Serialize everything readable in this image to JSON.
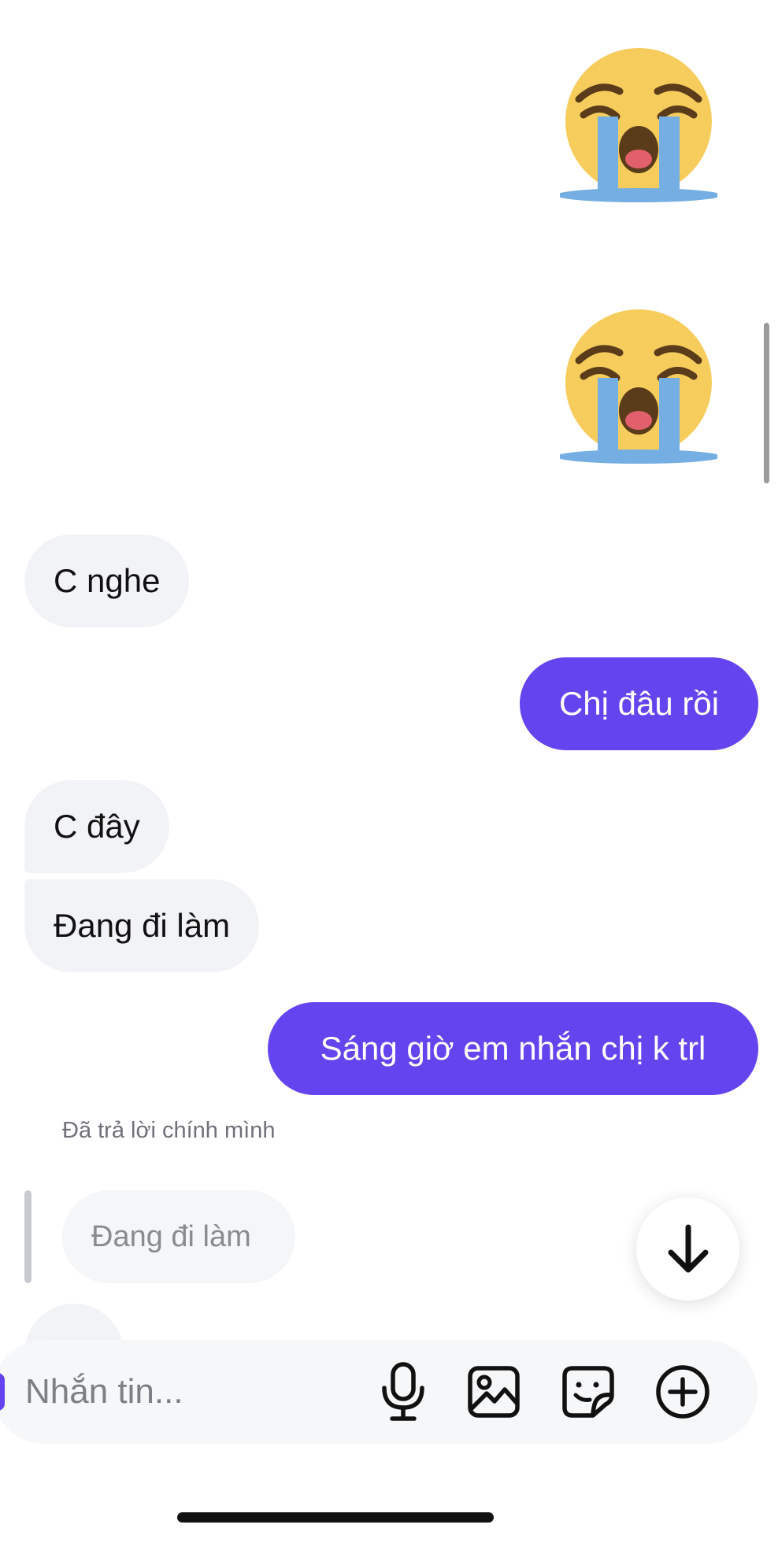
{
  "messages": [
    {
      "type": "emoji",
      "direction": "outgoing",
      "icon": "loudly-crying-face-emoji"
    },
    {
      "type": "emoji",
      "direction": "outgoing",
      "icon": "loudly-crying-face-emoji"
    },
    {
      "type": "text",
      "direction": "incoming",
      "text": "C nghe"
    },
    {
      "type": "text",
      "direction": "outgoing",
      "text": "Chị đâu rồi"
    },
    {
      "type": "text",
      "direction": "incoming",
      "text": "C đây"
    },
    {
      "type": "text",
      "direction": "incoming",
      "text": "Đang đi làm"
    },
    {
      "type": "text",
      "direction": "outgoing",
      "text": "Sáng giờ em nhắn chị k trl"
    }
  ],
  "reply": {
    "label": "Đã trả lời chính mình",
    "quoted_text": "Đang đi làm"
  },
  "scroll_down_icon": "arrow-down-icon",
  "composer": {
    "placeholder": "Nhắn tin...",
    "value": "",
    "icons": [
      "microphone-icon",
      "image-icon",
      "sticker-icon",
      "plus-circle-icon"
    ]
  },
  "colors": {
    "outgoing_bubble": "#6444ee",
    "incoming_bubble": "#f2f3f6",
    "background": "#ffffff"
  }
}
